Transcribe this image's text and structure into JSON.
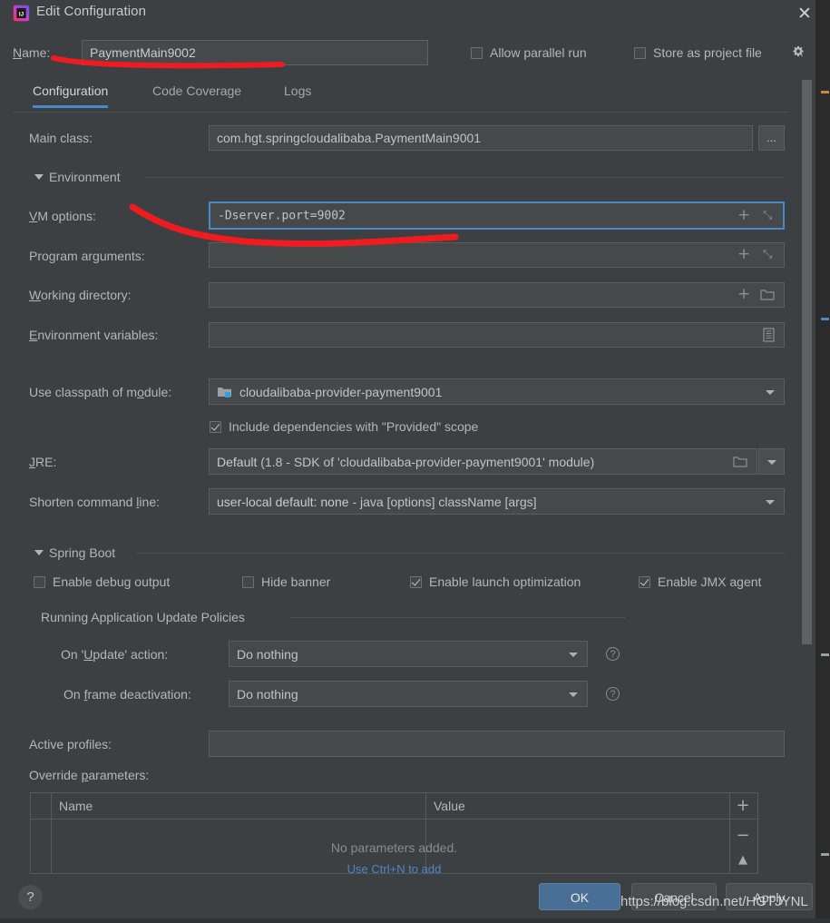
{
  "window": {
    "title": "Edit Configuration",
    "app_icon": "intellij-idea-icon",
    "close_icon": "close-icon"
  },
  "name_row": {
    "label": "Name:",
    "value": "PaymentMain9002",
    "allow_parallel_run": {
      "label": "Allow parallel run",
      "checked": false
    },
    "store_as_project_file": {
      "label": "Store as project file",
      "checked": false
    },
    "gear_icon": "gear-icon"
  },
  "tabs": [
    {
      "label": "Configuration",
      "active": true
    },
    {
      "label": "Code Coverage",
      "active": false
    },
    {
      "label": "Logs",
      "active": false
    }
  ],
  "form": {
    "main_class": {
      "label": "Main class:",
      "value": "com.hgt.springcloudalibaba.PaymentMain9001",
      "browse_label": "..."
    },
    "environment_section": {
      "label": "Environment"
    },
    "vm_options": {
      "label": "VM options:",
      "value": "-Dserver.port=9002",
      "focused": true
    },
    "program_arguments": {
      "label": "Program arguments:",
      "value": ""
    },
    "working_directory": {
      "label": "Working directory:",
      "value": ""
    },
    "environment_variables": {
      "label": "Environment variables:",
      "value": ""
    },
    "use_classpath_of_module": {
      "label": "Use classpath of module:",
      "value": "cloudalibaba-provider-payment9001",
      "icon": "module-folder-icon"
    },
    "include_provided": {
      "label": "Include dependencies with \"Provided\" scope",
      "checked": true
    },
    "jre": {
      "label": "JRE:",
      "value": "Default",
      "hint": "(1.8 - SDK of 'cloudalibaba-provider-payment9001' module)"
    },
    "shorten_command_line": {
      "label": "Shorten command line:",
      "value": "user-local default: none",
      "hint": "- java [options] className [args]"
    }
  },
  "spring_boot": {
    "section_label": "Spring Boot",
    "checkboxes": [
      {
        "label": "Enable debug output",
        "checked": false
      },
      {
        "label": "Hide banner",
        "checked": false
      },
      {
        "label": "Enable launch optimization",
        "checked": true
      },
      {
        "label": "Enable JMX agent",
        "checked": true
      }
    ],
    "update_policies": {
      "section_label": "Running Application Update Policies",
      "on_update_action": {
        "label": "On 'Update' action:",
        "value": "Do nothing",
        "help_icon": "question-mark-icon"
      },
      "on_frame_deactivation": {
        "label": "On frame deactivation:",
        "value": "Do nothing",
        "help_icon": "question-mark-icon"
      }
    },
    "active_profiles": {
      "label": "Active profiles:",
      "value": ""
    },
    "override_parameters": {
      "label": "Override parameters:",
      "columns": [
        "Name",
        "Value"
      ],
      "empty_text": "No parameters added.",
      "link_text": "Use Ctrl+N to add",
      "add_icon": "plus-icon",
      "remove_icon": "minus-icon",
      "move_up_icon": "triangle-up-icon"
    }
  },
  "footer": {
    "help_label": "?",
    "ok_label": "OK",
    "cancel_label": "Cancel",
    "apply_label": "Apply"
  },
  "watermark": {
    "text": "https://blog.csdn.net/HGTJYNL"
  },
  "colors": {
    "background": "#3c4043",
    "field_background": "#45494a",
    "accent_blue": "#4a88c7",
    "ok_button": "#4a6f97",
    "annotation_red": "#ee1c21",
    "text": "#b4b6b7"
  }
}
